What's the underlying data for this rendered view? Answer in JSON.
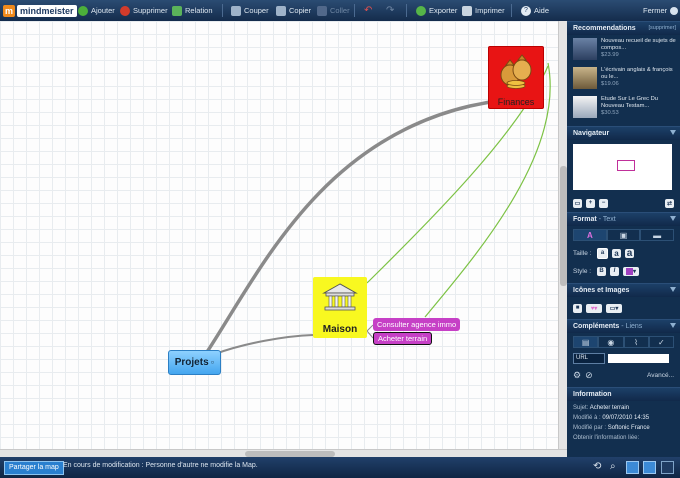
{
  "app": {
    "logo_initial": "m",
    "logo_text": "mindmeister",
    "close": "Fermer"
  },
  "toolbar": {
    "add": "Ajouter",
    "delete": "Supprimer",
    "relation": "Relation",
    "cut": "Couper",
    "copy": "Copier",
    "paste": "Coller",
    "export": "Exporter",
    "print": "Imprimer",
    "help": "Aide"
  },
  "map": {
    "root": "Projets",
    "maison": "Maison",
    "finances": "Finances",
    "sub1": "Consulter agence immo",
    "sub2": "Acheter terrain"
  },
  "panel": {
    "recommendations": {
      "title": "Recommendations",
      "action": "[supprimer]",
      "items": [
        {
          "title": "Nouveau recueil de sujets de compos...",
          "price": "$23.99"
        },
        {
          "title": "L'écrivain anglais & françois ou le...",
          "price": "$19.06"
        },
        {
          "title": "Etude Sur Le Grec Du Nouveau Testam...",
          "price": "$30.53"
        }
      ]
    },
    "navigator": {
      "title": "Navigateur"
    },
    "format": {
      "title": "Format",
      "sub": "- Text",
      "size_label": "Taille :",
      "style_label": "Style :"
    },
    "icons": {
      "title": "Icônes et Images"
    },
    "complements": {
      "title": "Compléments",
      "sub": "- Liens",
      "url_type": "URL",
      "advanced": "Avancé..."
    },
    "information": {
      "title": "Information",
      "rows": [
        {
          "label": "Sujet:",
          "value": "Acheter terrain"
        },
        {
          "label": "Modifié à :",
          "value": "09/07/2010 14:35"
        },
        {
          "label": "Modifié par :",
          "value": "Softonic France"
        },
        {
          "label": "Obtenir l'information liée:",
          "value": ""
        }
      ]
    }
  },
  "statusbar": {
    "share": "Partager la map",
    "status": "En cours de modification : Personne d'autre ne modifie la Map."
  },
  "colors": {
    "toolbar": "#1b3a60",
    "panel": "#122f4f",
    "maison": "#f8f820",
    "finances": "#e81414",
    "sub_node": "#c640c6",
    "root": "#44a6ef"
  }
}
